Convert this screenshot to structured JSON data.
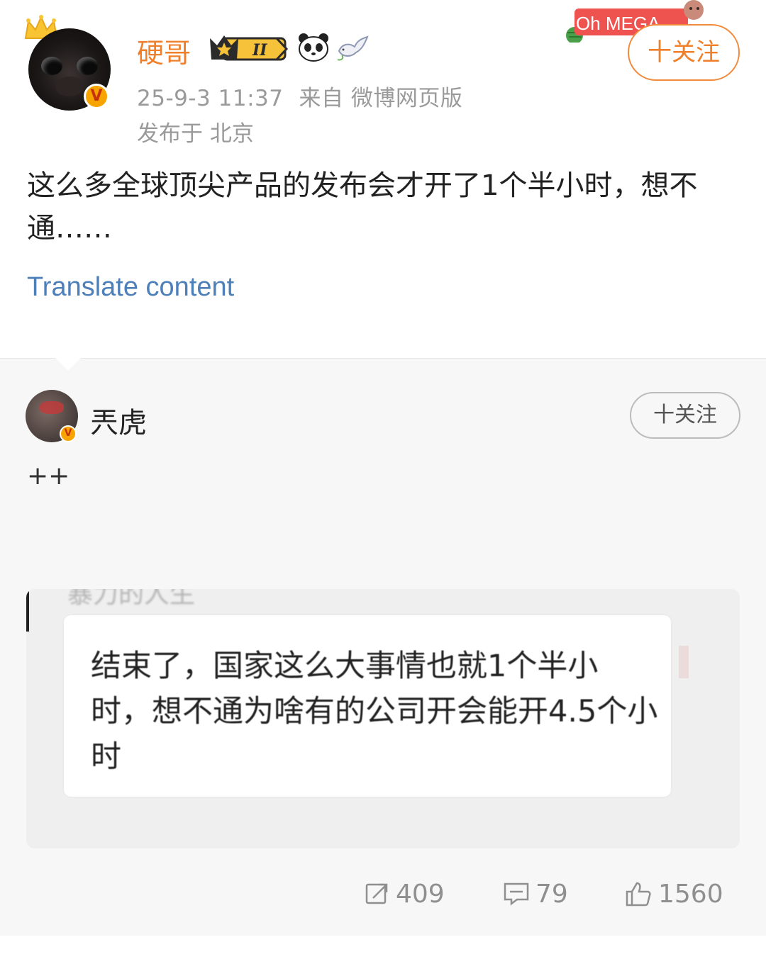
{
  "post": {
    "username": "硬哥",
    "meta_time": "25-9-3 11:37",
    "meta_source": "来自 微博网页版",
    "location": "发布于 北京",
    "follow_label": "十关注",
    "banner_text": "Oh MEGA",
    "level_badge": "II",
    "text": "这么多全球顶尖产品的发布会才开了1个半小时，想不通……",
    "translate_label": "Translate content"
  },
  "repost": {
    "username": "兲虎",
    "follow_label": "十关注",
    "text": "++",
    "image": {
      "top_text": "暴力的人生",
      "bubble_text": "结束了，国家这么大事情也就1个半小时，想不通为啥有的公司开会能开4.5个小时"
    }
  },
  "actions": {
    "reposts": "409",
    "comments": "79",
    "likes": "1560"
  },
  "colors": {
    "username": "#f07f2a",
    "link": "#4d7fb8",
    "meta": "#9a9a9a",
    "repost_bg": "#f7f7f7"
  },
  "icons": [
    "crown-icon",
    "verified-badge-icon",
    "level-badge-icon",
    "panda-icon",
    "dove-icon",
    "repost-icon",
    "comment-icon",
    "like-icon"
  ]
}
